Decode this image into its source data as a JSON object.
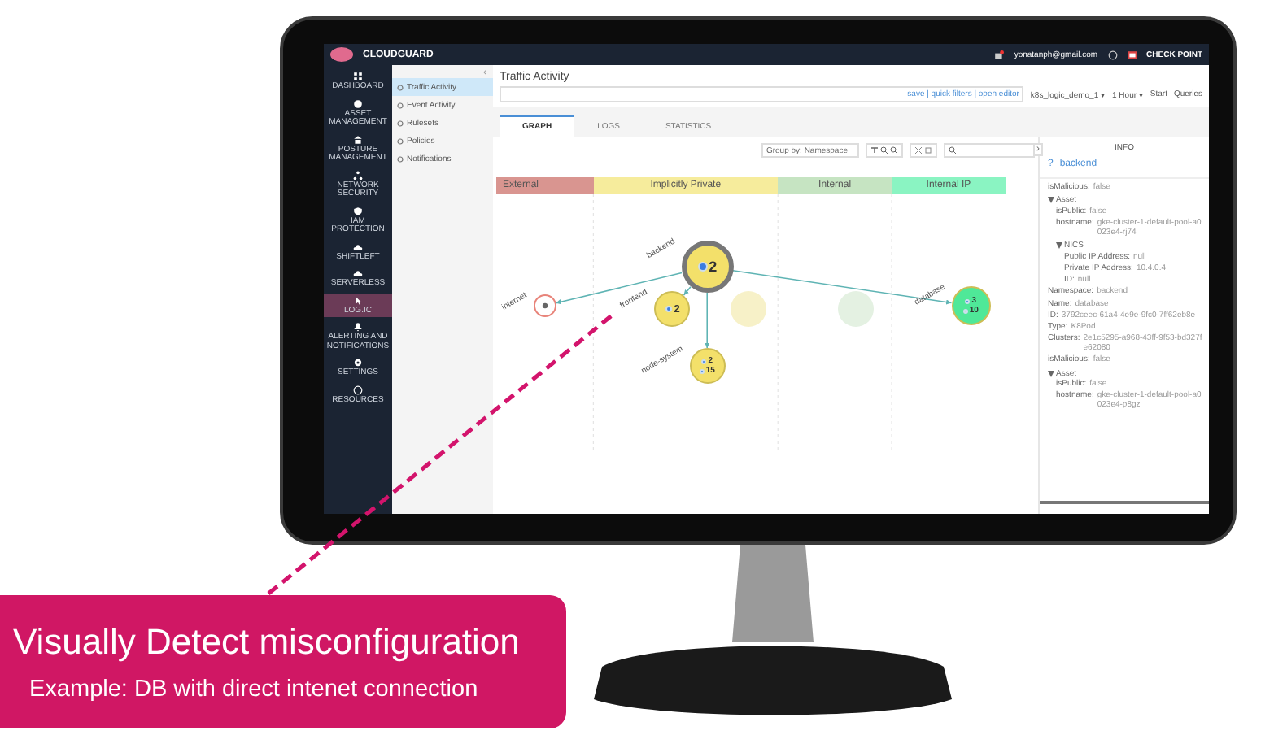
{
  "app": {
    "brand": "CLOUDGUARD",
    "user_email": "yonatanph@gmail.com",
    "vendor": "CHECK POINT"
  },
  "nav": [
    {
      "label": "DASHBOARD",
      "selected": false
    },
    {
      "label": "ASSET MANAGEMENT",
      "selected": false
    },
    {
      "label": "POSTURE MANAGEMENT",
      "selected": false
    },
    {
      "label": "NETWORK SECURITY",
      "selected": false
    },
    {
      "label": "IAM PROTECTION",
      "selected": false
    },
    {
      "label": "SHIFTLEFT",
      "selected": false
    },
    {
      "label": "SERVERLESS",
      "selected": false
    },
    {
      "label": "LOG.IC",
      "selected": true
    },
    {
      "label": "ALERTING AND NOTIFICATIONS",
      "selected": false
    },
    {
      "label": "SETTINGS",
      "selected": false
    },
    {
      "label": "RESOURCES",
      "selected": false
    }
  ],
  "submenu": {
    "collapse": "‹",
    "items": [
      {
        "label": "Traffic Activity",
        "selected": true
      },
      {
        "label": "Event Activity",
        "selected": false
      },
      {
        "label": "Rulesets",
        "selected": false
      },
      {
        "label": "Policies",
        "selected": false
      },
      {
        "label": "Notifications",
        "selected": false
      }
    ]
  },
  "page": {
    "title": "Traffic Activity",
    "filter_links": "save | quick filters | open editor",
    "environment": "k8s_logic_demo_1 ▾",
    "time_range": "1 Hour ▾",
    "start": "Start",
    "queries": "Queries"
  },
  "tabs": [
    {
      "label": "GRAPH",
      "selected": true
    },
    {
      "label": "LOGS",
      "selected": false
    },
    {
      "label": "STATISTICS",
      "selected": false
    }
  ],
  "toolbar": {
    "group_by": "Group by: Namespace"
  },
  "graph": {
    "zones": [
      {
        "label": "External",
        "color": "#d99590"
      },
      {
        "label": "Implicitly Private",
        "color": "#f6ec9c"
      },
      {
        "label": "Internal",
        "color": "#c6e4c2"
      },
      {
        "label": "Internal IP",
        "color": "#8af4c2"
      }
    ],
    "nodes": [
      {
        "kind": "external",
        "label": "internet",
        "color": "#ffffff"
      },
      {
        "kind": "hub",
        "label": "backend",
        "color": "#f3e06a",
        "counts": [
          {
            "value": "2",
            "active": true
          }
        ]
      },
      {
        "kind": "pod",
        "label": "frontend",
        "color": "#f3e06a",
        "counts": [
          {
            "value": "2",
            "active": true
          }
        ]
      },
      {
        "kind": "pod",
        "label": "node-system",
        "color": "#f3e06a",
        "counts": [
          {
            "value": "2",
            "active": true
          },
          {
            "value": "15",
            "active": true
          }
        ]
      },
      {
        "kind": "ghost",
        "color": "#f7f1c8"
      },
      {
        "kind": "ghost",
        "color": "#e4f1e2"
      },
      {
        "kind": "pod",
        "label": "database",
        "color": "#4fe898",
        "counts": [
          {
            "value": "3",
            "active": true
          },
          {
            "value": "10",
            "active": false
          }
        ]
      }
    ]
  },
  "info": {
    "toggle": "›",
    "title": "INFO",
    "help": "?",
    "entity": "backend",
    "properties": [
      {
        "label": "isMalicious:",
        "value": "false"
      },
      {
        "label": "Asset",
        "expanded": true,
        "children": [
          {
            "label": "isPublic:",
            "value": "false"
          },
          {
            "label": "hostname:",
            "value": "gke-cluster-1-default-pool-a0023e4-rj74"
          },
          {
            "label": "NICS",
            "expanded": true,
            "children": [
              {
                "label": "Public IP Address:",
                "value": "null"
              },
              {
                "label": "Private IP Address:",
                "value": "10.4.0.4"
              },
              {
                "label": "ID:",
                "value": "null"
              }
            ]
          }
        ]
      },
      {
        "label": "Namespace:",
        "value": "backend"
      },
      {
        "label": "Name:",
        "value": "database"
      },
      {
        "label": "ID:",
        "value": "3792ceec-61a4-4e9e-9fc0-7ff62eb8e"
      },
      {
        "label": "Type:",
        "value": "K8Pod"
      },
      {
        "label": "Clusters:",
        "value": "2e1c5295-a968-43ff-9f53-bd327fe62080"
      },
      {
        "label": "isMalicious:",
        "value": "false"
      },
      {
        "label": "Asset",
        "expanded": true,
        "children": [
          {
            "label": "isPublic:",
            "value": "false"
          },
          {
            "label": "hostname:",
            "value": "gke-cluster-1-default-pool-a0023e4-p8gz"
          }
        ]
      }
    ]
  },
  "callout": {
    "title": "Visually Detect misconfiguration",
    "subtitle": "Example: DB with direct intenet connection"
  }
}
